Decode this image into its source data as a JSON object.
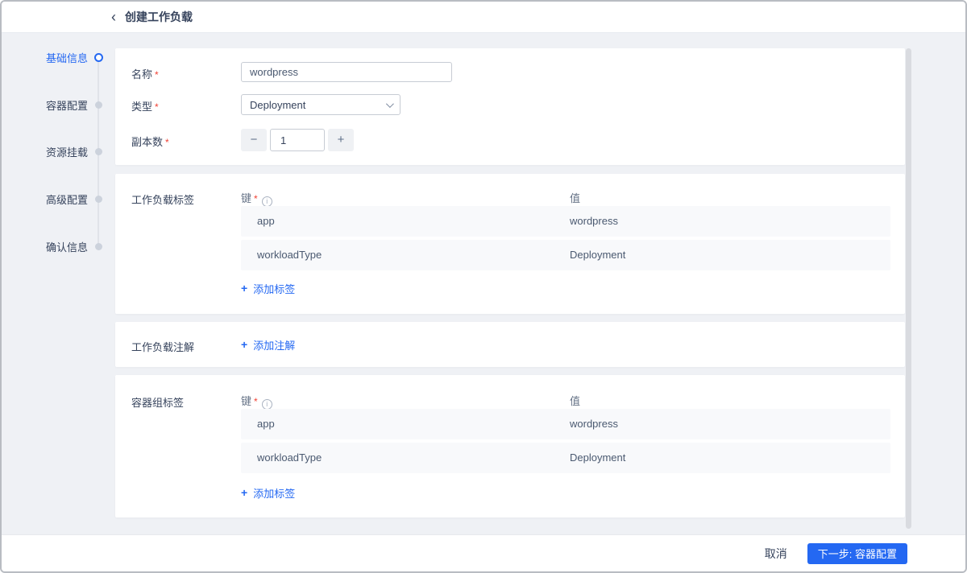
{
  "header": {
    "title": "创建工作负载"
  },
  "icons": {
    "back": "‹",
    "plus": "+",
    "minus": "−",
    "info": "i"
  },
  "steps": {
    "items": [
      {
        "label": "基础信息",
        "state": "active"
      },
      {
        "label": "容器配置",
        "state": "upcoming"
      },
      {
        "label": "资源挂载",
        "state": "upcoming"
      },
      {
        "label": "高级配置",
        "state": "upcoming"
      },
      {
        "label": "确认信息",
        "state": "upcoming"
      }
    ]
  },
  "form": {
    "required_mark": "*",
    "name_label": "名称",
    "name_value": "wordpress",
    "type_label": "类型",
    "type_value": "Deployment",
    "replicas_label": "副本数",
    "replicas_value": "1"
  },
  "workload_labels": {
    "section_label": "工作负载标签",
    "key_header": "键",
    "value_header": "值",
    "rows": [
      {
        "key": "app",
        "value": "wordpress"
      },
      {
        "key": "workloadType",
        "value": "Deployment"
      }
    ],
    "add_label": "添加标签"
  },
  "workload_annotations": {
    "section_label": "工作负载注解",
    "add_label": "添加注解"
  },
  "pod_labels": {
    "section_label": "容器组标签",
    "key_header": "键",
    "value_header": "值",
    "rows": [
      {
        "key": "app",
        "value": "wordpress"
      },
      {
        "key": "workloadType",
        "value": "Deployment"
      }
    ],
    "add_label": "添加标签"
  },
  "footer": {
    "cancel_label": "取消",
    "next_label": "下一步: 容器配置"
  },
  "colors": {
    "primary": "#2468f2",
    "page_bg": "#eff1f5",
    "card_bg": "#ffffff",
    "row_bg": "#f8f9fb",
    "text_dark": "#36435c",
    "text_muted": "#667387",
    "required": "#f04134"
  }
}
